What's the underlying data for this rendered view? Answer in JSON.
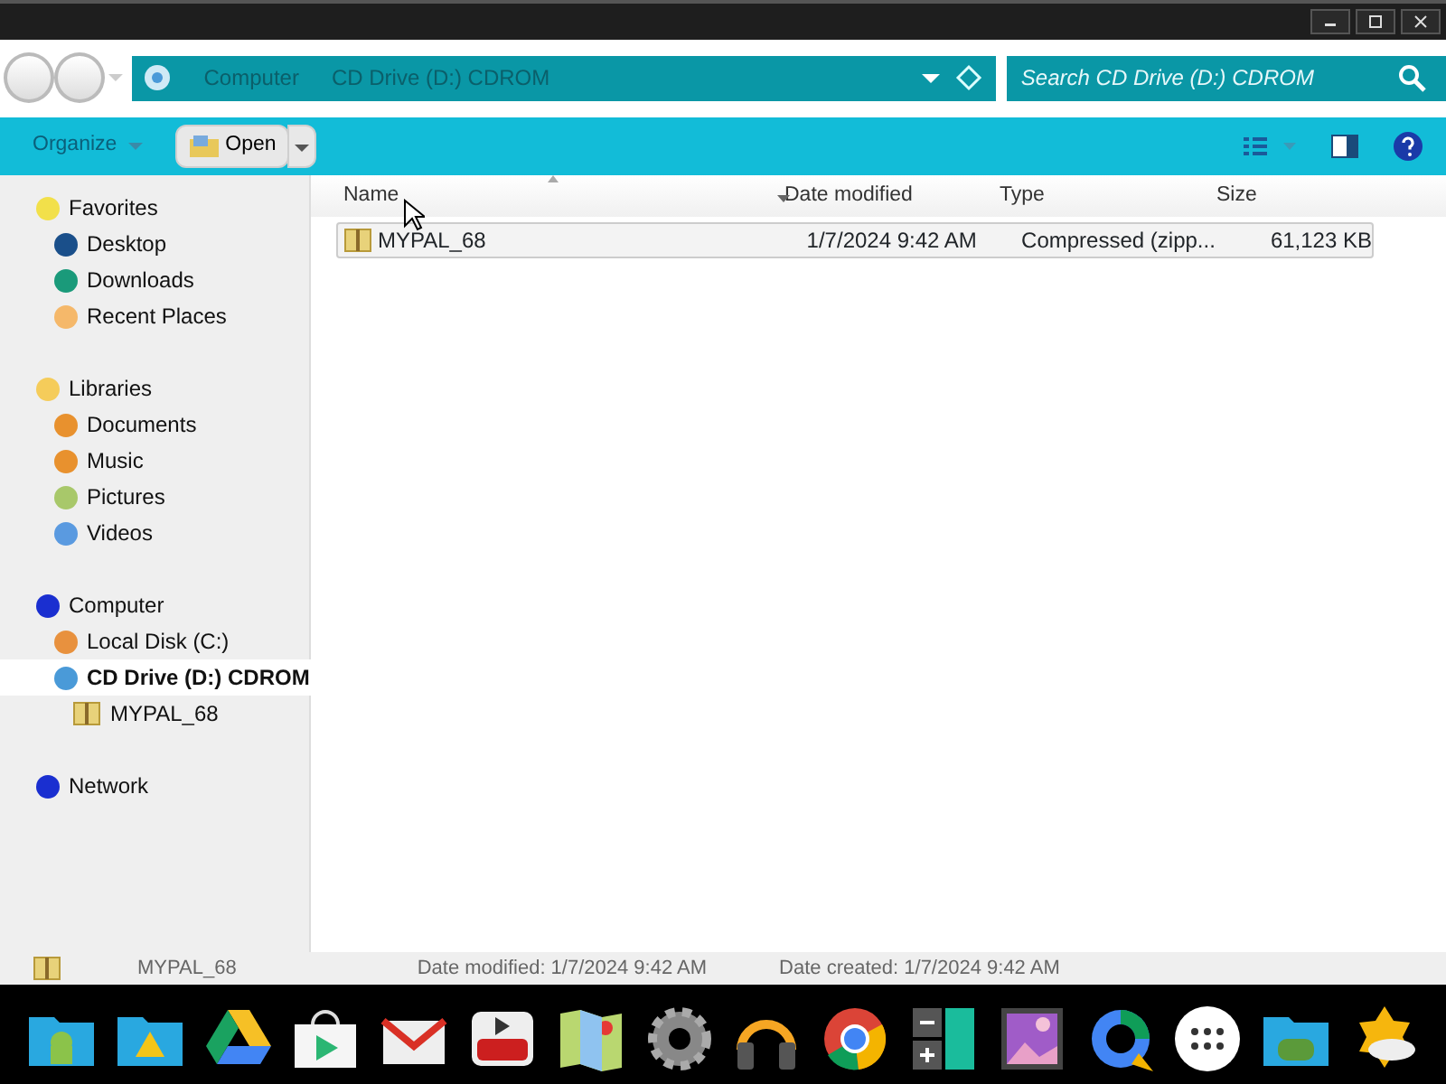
{
  "address_bar": {
    "breadcrumbs": [
      "Computer",
      "CD Drive (D:) CDROM"
    ]
  },
  "search": {
    "placeholder": "Search CD Drive (D:) CDROM"
  },
  "toolbar": {
    "organize": "Organize",
    "open": "Open"
  },
  "sidebar": {
    "groups": [
      {
        "label": "Favorites",
        "color": "#f2e04a",
        "selected": false,
        "children": [
          {
            "label": "Desktop",
            "color": "#1a4f8a",
            "selected": false
          },
          {
            "label": "Downloads",
            "color": "#1a9a7a",
            "selected": false
          },
          {
            "label": "Recent Places",
            "color": "#f5b86a",
            "selected": false
          }
        ]
      },
      {
        "label": "Libraries",
        "color": "#f5cc5a",
        "selected": false,
        "children": [
          {
            "label": "Documents",
            "color": "#e8912e",
            "selected": false
          },
          {
            "label": "Music",
            "color": "#e8912e",
            "selected": false
          },
          {
            "label": "Pictures",
            "color": "#a8c86a",
            "selected": false
          },
          {
            "label": "Videos",
            "color": "#5a9ae0",
            "selected": false
          }
        ]
      },
      {
        "label": "Computer",
        "color": "#1a2fd0",
        "selected": false,
        "children": [
          {
            "label": "Local Disk (C:)",
            "color": "#e8913e",
            "selected": false
          },
          {
            "label": "CD Drive (D:) CDROM",
            "color": "#4a9ad8",
            "selected": true,
            "children": [
              {
                "label": "MYPAL_68",
                "kind": "zip",
                "selected": false
              }
            ]
          }
        ]
      },
      {
        "label": "Network",
        "color": "#1a2fd0",
        "selected": false
      }
    ]
  },
  "table": {
    "columns": [
      {
        "label": "Name",
        "sorted": true
      },
      {
        "label": "Date modified",
        "sorted": false
      },
      {
        "label": "Type",
        "sorted": false
      },
      {
        "label": "Size",
        "sorted": false
      }
    ],
    "rows": [
      {
        "name": "MYPAL_68",
        "date_modified": "1/7/2024 9:42 AM",
        "type": "Compressed (zipp...",
        "size": "61,123 KB",
        "selected": true
      }
    ]
  },
  "status_bar": {
    "name": "MYPAL_68",
    "date_modified": "Date modified: 1/7/2024 9:42 AM",
    "date_created": "Date created: 1/7/2024 9:42 AM"
  }
}
